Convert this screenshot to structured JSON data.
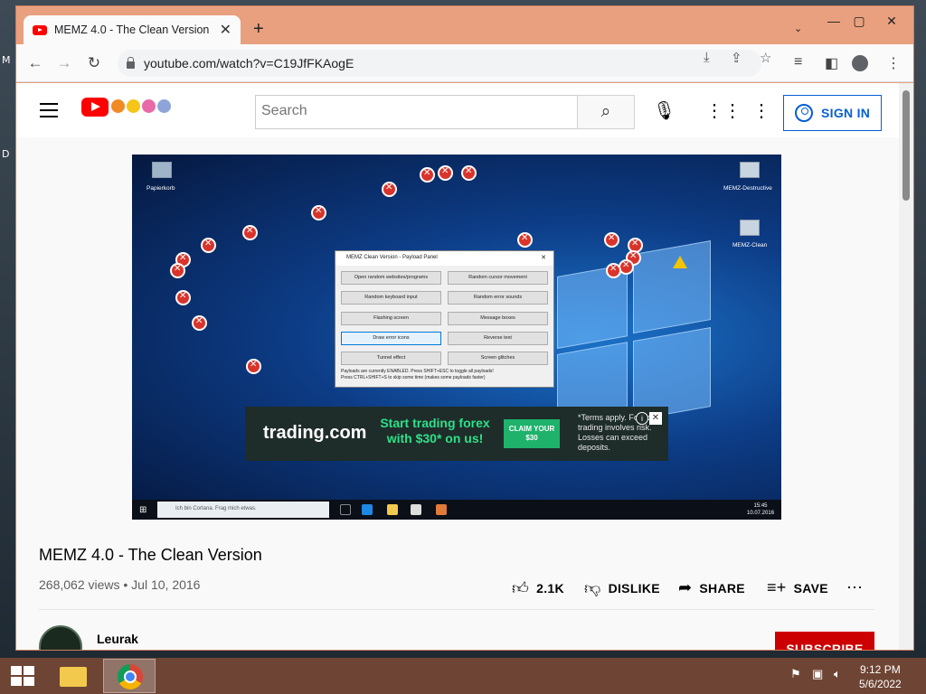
{
  "desktop": {
    "side_letters": [
      "M",
      "D"
    ]
  },
  "browser": {
    "tab": {
      "title": "MEMZ 4.0 - The Clean Version - Y",
      "close": "✕",
      "icon": "youtube-favicon"
    },
    "new_tab": "+",
    "tab_dropdown": "⌄",
    "window_controls": {
      "minimize": "—",
      "maximize": "▢",
      "close": "✕"
    },
    "nav": {
      "back": "←",
      "forward": "→",
      "reload": "↻"
    },
    "url": "youtube.com/watch?v=C19JfFKAogE",
    "toolbar_icons": [
      "install-icon",
      "share-icon",
      "star-icon",
      "media-icon",
      "sidepanel-icon",
      "profile-icon",
      "menu-icon"
    ]
  },
  "youtube": {
    "search_placeholder": "Search",
    "sign_in": "SIGN IN",
    "video_title": "MEMZ 4.0 - The Clean Version",
    "meta": "268,062 views • Jul 10, 2016",
    "actions": {
      "like": "2.1K",
      "dislike": "DISLIKE",
      "share": "SHARE",
      "save": "SAVE",
      "more": "⋯"
    },
    "channel": {
      "name": "Leurak"
    },
    "subscribe": "SUBSCRIBE"
  },
  "video_frame": {
    "desktop_icons": {
      "recycle": "Papierkorb",
      "destructive": "MEMZ-Destructive",
      "clean": "MEMZ-Clean"
    },
    "payload_panel": {
      "title": "MEMZ Clean Version - Payload Panel",
      "buttons": [
        "Open random websites/programs",
        "Random cursor movement",
        "Random keyboard input",
        "Random error sounds",
        "Flashing screen",
        "Message boxes",
        "Draw error icons",
        "Reverse text",
        "Tunnel effect",
        "Screen glitches"
      ],
      "note_1": "Payloads are currently ENABLED. Press SHIFT+ESC to toggle all payloads!",
      "note_2": "Press CTRL+SHIFT+S to skip some time (makes some payloads faster)"
    },
    "ad": {
      "brand": "trading.com",
      "headline": "Start trading forex with $30* on us!",
      "cta": "CLAIM YOUR $30",
      "fine_print": "*Terms apply. Forex trading involves risk. Losses can exceed deposits.",
      "info": "i",
      "close": "✕"
    },
    "taskbar": {
      "search_hint": "Ich bin Cortana. Frag mich etwas.",
      "time": "15:45",
      "date": "10.07.2016"
    }
  },
  "os_taskbar": {
    "time": "9:12 PM",
    "date": "5/6/2022"
  }
}
